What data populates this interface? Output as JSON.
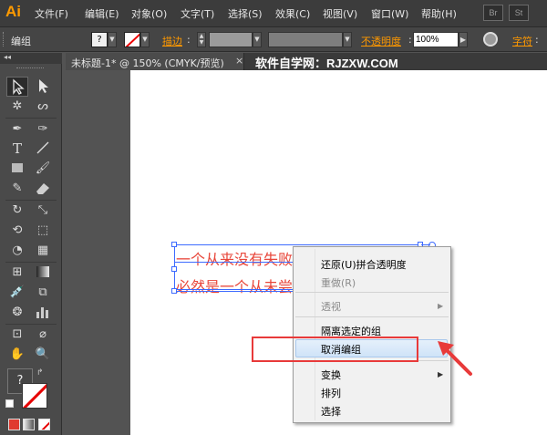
{
  "menubar": {
    "logo": "Ai",
    "items": [
      "文件(F)",
      "编辑(E)",
      "对象(O)",
      "文字(T)",
      "选择(S)",
      "效果(C)",
      "视图(V)",
      "窗口(W)",
      "帮助(H)"
    ],
    "right_boxes": [
      "Br",
      "St"
    ]
  },
  "control_bar": {
    "group_label": "编组",
    "stroke_label": "描边",
    "opacity_label": "不透明度",
    "opacity_value": "100%",
    "style_label": "字符"
  },
  "document": {
    "tab_title": "未标题-1* @ 150% (CMYK/预览)",
    "tab_close": "×"
  },
  "watermark": "软件自学网：RJZXW.COM",
  "toolbox": {
    "collapse": "◂◂",
    "tools": [
      "selection",
      "direct-selection",
      "magic-wand",
      "lasso",
      "pen",
      "curvature",
      "type",
      "line",
      "rectangle",
      "paintbrush",
      "pencil",
      "eraser",
      "rotate",
      "scale",
      "warp",
      "free-transform",
      "shape-builder",
      "graph",
      "mesh",
      "gradient",
      "eyedropper",
      "blend",
      "symbol-sprayer",
      "column-graph",
      "artboard",
      "slice",
      "hand",
      "zoom"
    ],
    "fill_stroke_help": "?",
    "colors": {
      "fill": "#ffffff",
      "stroke_none": "#e60000",
      "swatch_color": "#e03a2f",
      "swatch_gradient": "#9a9a9a"
    }
  },
  "artboard": {
    "line1": "一个从来没有失败过的人",
    "line2": "必然是一个从未尝试过什么的人",
    "text_color": "#e8463a"
  },
  "context_menu": {
    "items": [
      {
        "label": "还原(U)拼合透明度",
        "disabled": false
      },
      {
        "label": "重做(R)",
        "disabled": true
      },
      {
        "label": "透视",
        "disabled": true,
        "submenu": true
      },
      {
        "label": "隔离选定的组",
        "disabled": false
      },
      {
        "label": "取消编组",
        "disabled": false,
        "highlighted": true
      },
      {
        "label": "变换",
        "disabled": false,
        "submenu": true
      },
      {
        "label": "排列",
        "disabled": false
      },
      {
        "label": "选择",
        "disabled": false
      }
    ]
  },
  "annotation": {
    "highlight_color": "#e83a3a"
  }
}
